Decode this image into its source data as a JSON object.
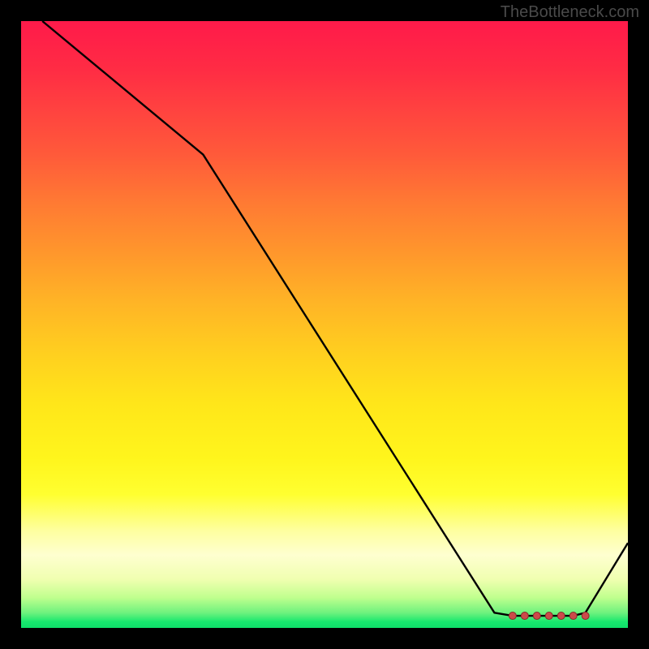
{
  "watermark": "TheBottleneck.com",
  "chart_data": {
    "type": "line",
    "title": "",
    "xlabel": "",
    "ylabel": "",
    "xlim": [
      0,
      100
    ],
    "ylim": [
      0,
      100
    ],
    "series": [
      {
        "name": "curve",
        "x": [
          3.5,
          30,
          78,
          81,
          83,
          85,
          87,
          89,
          91,
          93,
          100
        ],
        "values": [
          100,
          78,
          2.5,
          2,
          2,
          2,
          2,
          2,
          2,
          2.5,
          14
        ]
      }
    ],
    "markers": {
      "x": [
        81,
        83,
        85,
        87,
        89,
        91,
        93
      ],
      "values": [
        2,
        2,
        2,
        2,
        2,
        2,
        2
      ]
    },
    "background_gradient": {
      "top": "#ff1a4a",
      "mid": "#ffe61a",
      "bottom": "#0fdf6a"
    }
  }
}
